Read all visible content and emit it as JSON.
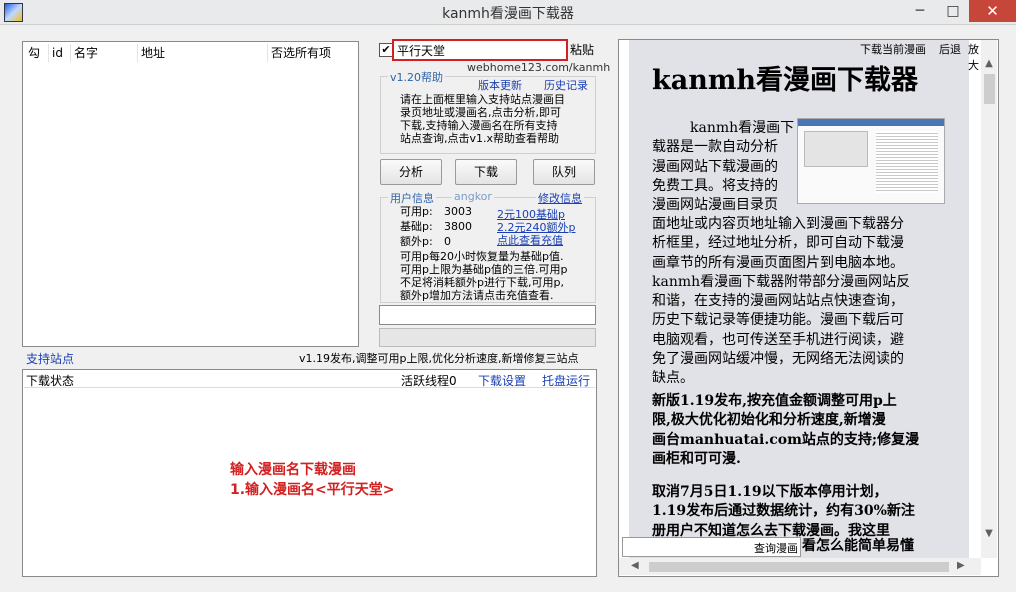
{
  "window": {
    "title": "kanmh看漫画下载器",
    "minimize": "─",
    "maximize": "□",
    "close": "✕"
  },
  "task_list": {
    "columns": [
      "勾",
      "id",
      "名字",
      "地址",
      "否选所有项"
    ]
  },
  "search": {
    "checked": true,
    "value": "平行天堂",
    "paste_label": "粘贴",
    "site_url": "webhome123.com/kanmh"
  },
  "help": {
    "group_label": "v1.20帮助",
    "version_update": "版本更新",
    "history": "历史记录",
    "text_lines": [
      "请在上面框里输入支持站点漫画目",
      "录页地址或漫画名,点击分析,即可",
      "下载,支持输入漫画名在所有支持",
      "站点查询,点击v1.x帮助查看帮助"
    ]
  },
  "actions": {
    "analyze": "分析",
    "download": "下载",
    "queue": "队列"
  },
  "user": {
    "group_label": "用户信息",
    "username": "angkor",
    "edit_info": "修改信息",
    "available_label": "可用p:",
    "available_value": "3003",
    "base_label": "基础p:",
    "base_value": "3800",
    "extra_label": "额外p:",
    "extra_value": "0",
    "link_1": "2元100基础p",
    "link_2": "2.2元240额外p",
    "link_3": "点此查看充值",
    "note_lines": [
      "可用p每20小时恢复量为基础p值.",
      "可用p上限为基础p值的三倍.可用p",
      "不足将消耗额外p进行下载,可用p,",
      "额外p增加方法请点击充值查看."
    ]
  },
  "support_sites": "支持站点",
  "release_note": "v1.19发布,调整可用p上限,优化分析速度,新增修复三站点",
  "download_panel": {
    "status_label": "下载状态",
    "active_threads": "活跃线程0",
    "settings": "下载设置",
    "tray": "托盘运行",
    "annotation_line1": "输入漫画名下载漫画",
    "annotation_line2": "1.输入漫画名<平行天堂>"
  },
  "browser": {
    "toolbar": [
      "下载当前漫画",
      "后退",
      "放大"
    ],
    "doc_title": "kanmh看漫画下载器",
    "intro_lines": [
      "kanmh看漫画下",
      "载器是一款自动分析",
      "漫画网站下载漫画的",
      "免费工具。将支持的",
      "漫画网站漫画目录页"
    ],
    "body_lines": [
      "面地址或内容页地址输入到漫画下载器分",
      "析框里，经过地址分析，即可自动下载漫",
      "画章节的所有漫画页面图片到电脑本地。",
      "kanmh看漫画下载器附带部分漫画网站反",
      "和谐，在支持的漫画网站站点快速查询，",
      "历史下载记录等便捷功能。漫画下载后可",
      "电脑观看，也可传送至手机进行阅读，避",
      "免了漫画网站缓冲慢，无网络无法阅读的",
      "缺点。"
    ],
    "bold_lines_1": [
      "新版1.19发布,按充值金额调整可用p上",
      "限,极大优化初始化和分析速度,新增漫",
      "画台manhuatai.com站点的支持;修复漫",
      "画柜和可可漫."
    ],
    "bold_lines_2": [
      "取消7月5日1.19以下版本停用计划，",
      "1.19发布后通过数据统计，约有30%新注",
      "册用户不知道怎么去下载漫画。我这里"
    ],
    "last_line_tail": "看怎么能简单易懂",
    "query_button": "查询漫画"
  },
  "colors": {
    "accent_red": "#d42020",
    "link_blue": "#1a3fb3",
    "group_blue": "#2e64a8"
  }
}
